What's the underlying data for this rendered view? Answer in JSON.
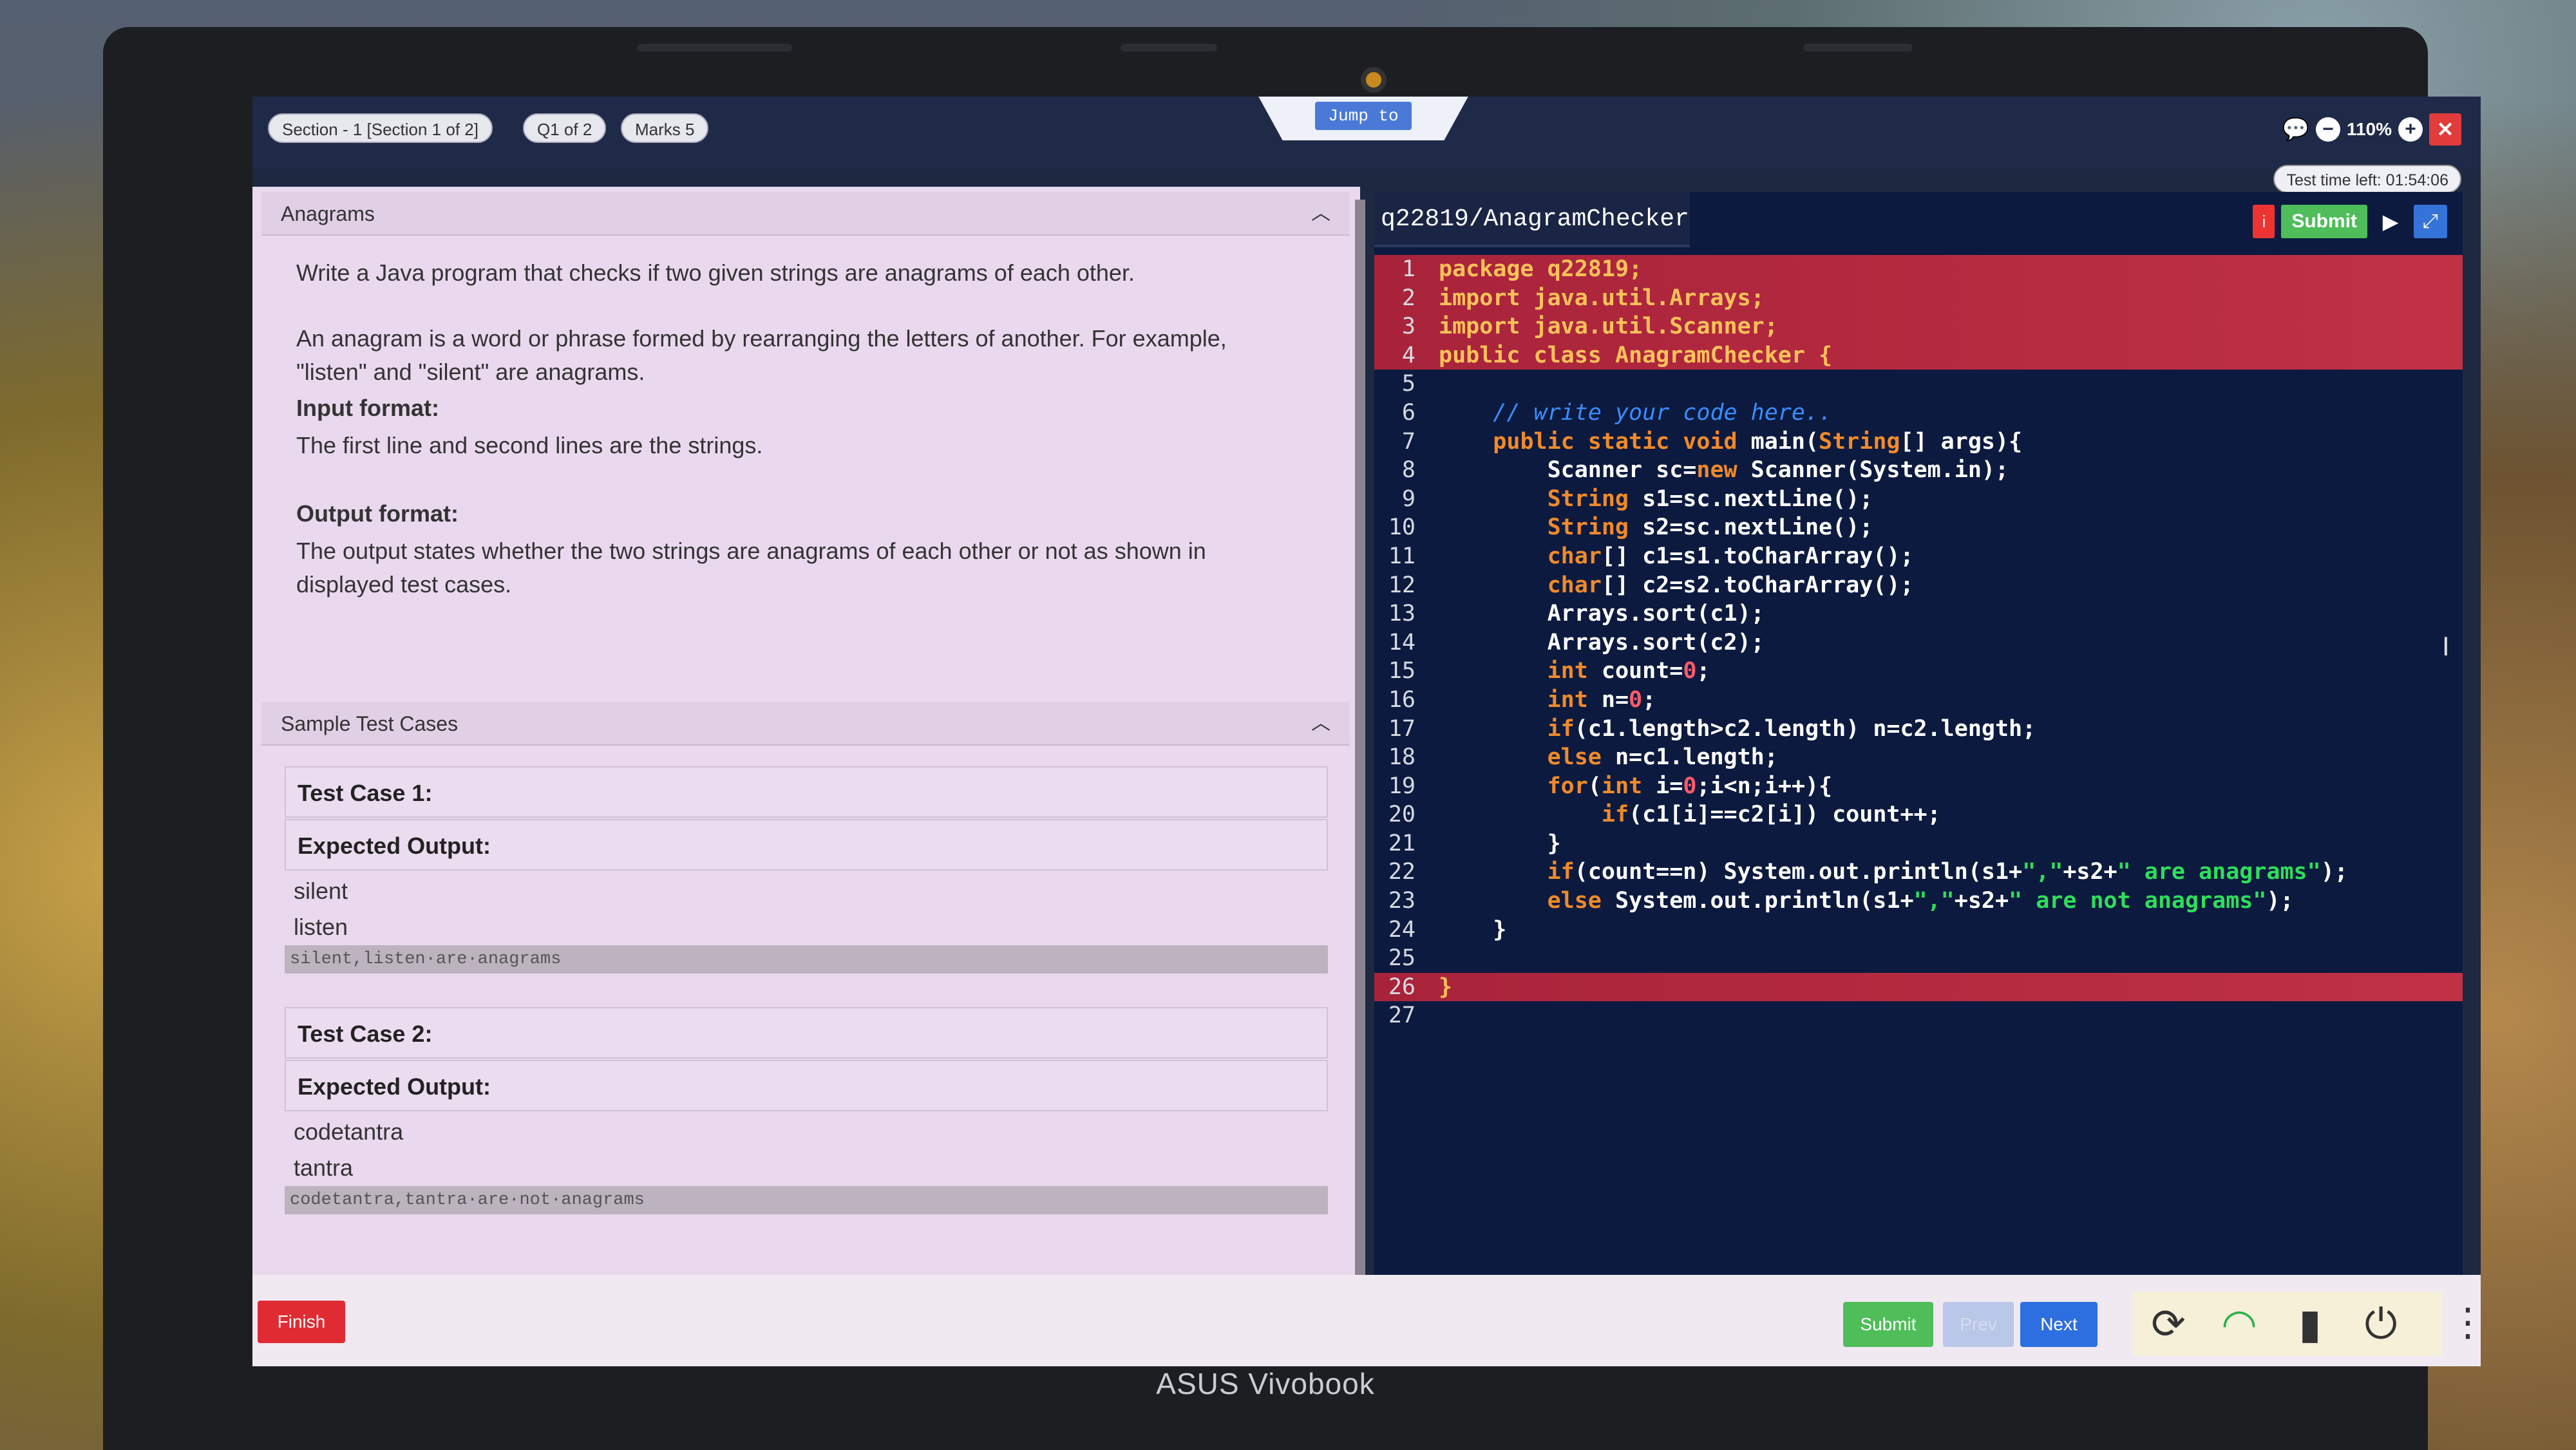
{
  "header": {
    "section": "Section - 1 [Section 1 of 2]",
    "question": "Q1 of 2",
    "marks": "Marks 5",
    "jump": "Jump to",
    "zoom": "110%",
    "close": "✕",
    "timer": "Test time left: 01:54:06"
  },
  "problem": {
    "title": "Anagrams",
    "p1": "Write a Java program that checks if two given strings are anagrams of each other.",
    "p2": "An anagram is a word or phrase formed by rearranging the letters of another. For example, \"listen\" and \"silent\" are anagrams.",
    "input_label": "Input format:",
    "input_text": "The first line and second lines are the strings.",
    "output_label": "Output format:",
    "output_text": "The output states whether the two strings are anagrams of each other or not as shown in displayed test cases."
  },
  "tests": {
    "title": "Sample Test Cases",
    "tc1": {
      "label": "Test Case 1:",
      "expected": "Expected Output:",
      "in1": "silent",
      "in2": "listen",
      "out": "silent,listen·are·anagrams"
    },
    "tc2": {
      "label": "Test Case 2:",
      "expected": "Expected Output:",
      "in1": "codetantra",
      "in2": "tantra",
      "out": "codetantra,tantra·are·not·anagrams"
    }
  },
  "editor": {
    "filename": "q22819/AnagramChecker",
    "tool_info": "i",
    "tool_submit": "Submit",
    "tool_run": "▶",
    "tool_expand": "⤢"
  },
  "footer": {
    "finish": "Finish",
    "submit": "Submit",
    "prev": "Prev",
    "next": "Next",
    "menu": "⋮"
  },
  "laptop": {
    "brand": "ASUS Vivobook"
  }
}
